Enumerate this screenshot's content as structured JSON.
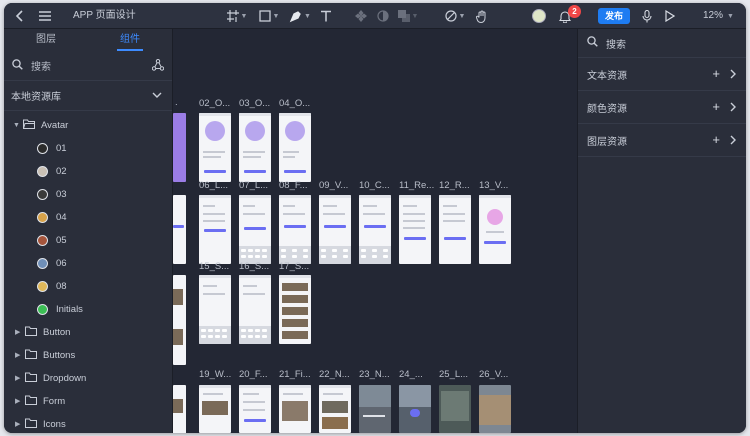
{
  "app": {
    "title": "APP 页面设计",
    "zoom": "12%",
    "publish_label": "发布",
    "notification_count": "2"
  },
  "icons": {
    "back": "chevron-left-icon",
    "menu": "hamburger-menu-icon",
    "frame": "frame-tool-icon",
    "shape": "rectangle-tool-icon",
    "pen": "pen-tool-icon",
    "text": "text-tool-icon",
    "component": "component-icon",
    "mask": "mask-icon",
    "boolean": "boolean-icon",
    "slice": "slice-icon",
    "hand": "hand-tool-icon",
    "bell": "bell-icon",
    "mic": "microphone-icon",
    "play": "play-icon"
  },
  "left_panel": {
    "tabs": [
      {
        "label": "图层",
        "active": false
      },
      {
        "label": "组件",
        "active": true
      }
    ],
    "search_placeholder": "搜索",
    "library_label": "本地资源库",
    "tree": {
      "group": "Avatar",
      "avatars": [
        {
          "label": "01",
          "color": "#2b2b2b"
        },
        {
          "label": "02",
          "color": "#c9c0b4"
        },
        {
          "label": "03",
          "color": "#3a3a3a"
        },
        {
          "label": "04",
          "color": "#d7a24a"
        },
        {
          "label": "05",
          "color": "#a5553c"
        },
        {
          "label": "06",
          "color": "#6f8fb8"
        },
        {
          "label": "08",
          "color": "#e0b85a"
        },
        {
          "label": "Initials",
          "color": "#3cbf55"
        }
      ],
      "folders": [
        "Button",
        "Buttons",
        "Dropdown",
        "Form",
        "Icons"
      ]
    }
  },
  "canvas": {
    "row_labels": [
      [
        "02_O...",
        "03_O...",
        "04_O..."
      ],
      [
        "06_L...",
        "07_L...",
        "08_F...",
        "09_V...",
        "10_C...",
        "11_Re...",
        "12_R...",
        "13_V..."
      ],
      [
        "15_S...",
        "16_S...",
        "17_S..."
      ],
      [
        "19_W...",
        "20_F...",
        "21_Fi...",
        "22_N...",
        "23_N...",
        "24_...",
        "25_L...",
        "26_V..."
      ]
    ]
  },
  "right_panel": {
    "search_placeholder": "搜索",
    "sections": [
      {
        "label": "文本资源"
      },
      {
        "label": "颜色资源"
      },
      {
        "label": "图层资源"
      }
    ]
  }
}
